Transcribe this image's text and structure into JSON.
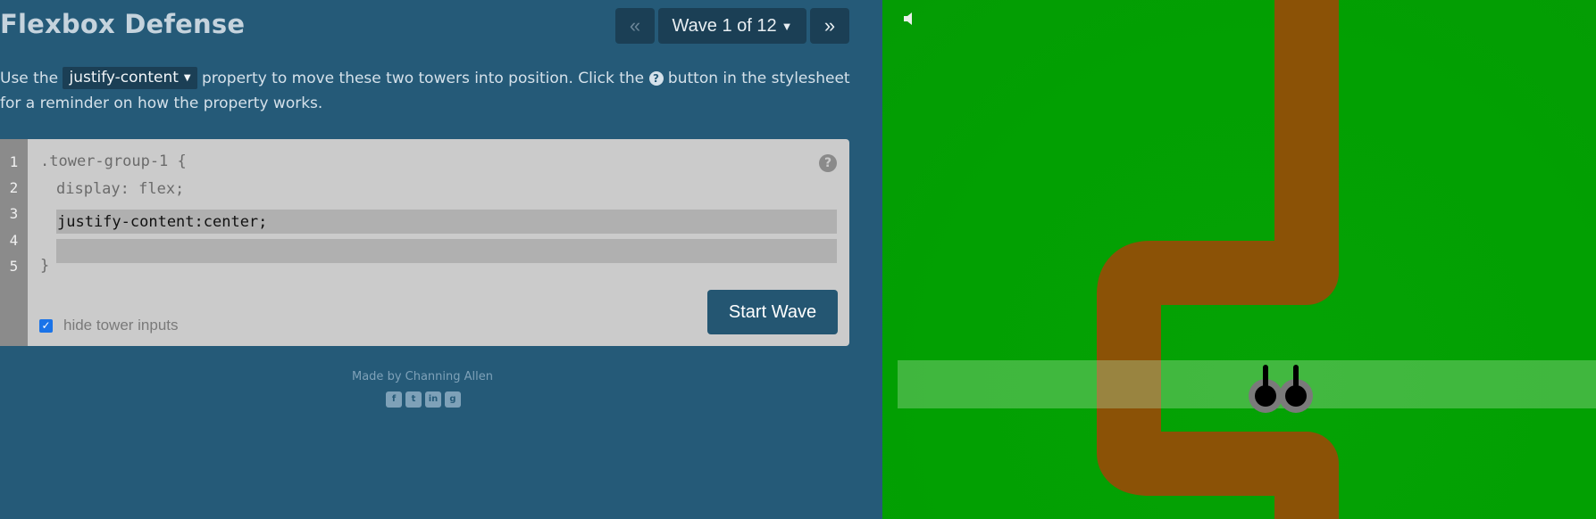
{
  "game": {
    "title": "Flexbox Defense",
    "nav": {
      "prev_label": "«",
      "wave_label": "Wave 1 of 12",
      "next_label": "»"
    }
  },
  "instructions": {
    "before": "Use the ",
    "property": "justify-content",
    "middle": " property to move these two towers into position. Click the ",
    "after": " button in the stylesheet for a reminder on how the property works."
  },
  "editor": {
    "line_numbers": [
      "1",
      "2",
      "3",
      "4",
      "5"
    ],
    "selector_line": ".tower-group-1 {",
    "display_line": "display: flex;",
    "input_value": "justify-content:center;",
    "input2_value": "",
    "closing_line": "}",
    "hide_label": "hide tower inputs",
    "hide_checked": true,
    "start_label": "Start Wave"
  },
  "footer": {
    "credit": "Made by Channing Allen",
    "social": [
      "facebook-icon",
      "twitter-icon",
      "linkedin-icon",
      "github-icon"
    ]
  },
  "colors": {
    "panel": "#255a78",
    "grass": "#02a002",
    "path": "#8b5206",
    "button": "#245672"
  },
  "towers": {
    "count": 2
  }
}
